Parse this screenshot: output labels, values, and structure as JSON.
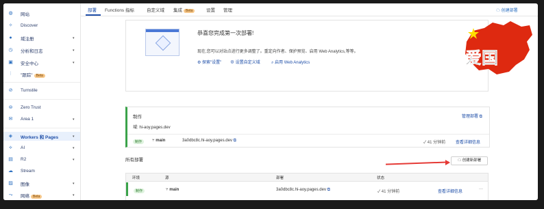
{
  "sidebar": {
    "items": [
      {
        "label": "网站",
        "icon": "globe-icon"
      },
      {
        "label": "Discover",
        "icon": "lightbulb-icon"
      },
      {
        "label": "域注册",
        "icon": "globe-icon",
        "caret": "▾"
      },
      {
        "label": "分析和日志",
        "icon": "clock-icon",
        "caret": "▾"
      },
      {
        "label": "安全中心",
        "icon": "shield-icon",
        "caret": "▾"
      },
      {
        "label": "\"跟踪\"",
        "icon": "route-icon",
        "beta": "Beta"
      },
      {
        "label": "Turnstile",
        "icon": "turnstile-icon"
      },
      {
        "label": "Zero Trust",
        "icon": "zero-trust-icon"
      },
      {
        "label": "Area 1",
        "icon": "mail-icon",
        "caret": "▾"
      },
      {
        "label": "Workers 和 Pages",
        "icon": "workers-icon",
        "caret": "▾"
      },
      {
        "label": "AI",
        "icon": "ai-icon",
        "caret": "▾"
      },
      {
        "label": "R2",
        "icon": "database-icon",
        "caret": "▾"
      },
      {
        "label": "Stream",
        "icon": "cloud-icon"
      },
      {
        "label": "图像",
        "icon": "image-icon",
        "caret": "▾"
      },
      {
        "label": "网络",
        "icon": "network-icon",
        "beta": "Beta",
        "caret": "▾"
      }
    ]
  },
  "tabs": [
    {
      "label": "部署"
    },
    {
      "label": "Functions 指标"
    },
    {
      "label": "自定义域"
    },
    {
      "label": "集成",
      "beta": "Beta"
    },
    {
      "label": "设置"
    },
    {
      "label": "管理"
    }
  ],
  "header": {
    "create_deployment_link": "创建部署"
  },
  "congrats": {
    "title": "恭喜您完成第一次部署!",
    "description": "现在,您可以对站点进行更多调整了。重定向作者、保护预览、启用 Web Analytics,等等。",
    "links": [
      "探索\"设置\"",
      "设置自定义域",
      "启用 Web Analytics"
    ]
  },
  "production": {
    "label": "制作",
    "domain_prefix": "域:",
    "domain": "hi-aoy.pages.dev",
    "manage_link": "管理部署",
    "badge": "制作",
    "branch": "main",
    "deployment": "3a0dbc8c.hi-aoy.pages.dev",
    "time": "41 分钟前",
    "details_link": "查看详细信息"
  },
  "all_deployments": {
    "title": "所有部署",
    "create_button": "创建新部署",
    "headers": [
      "环境",
      "源",
      "部署",
      "状态"
    ],
    "rows": [
      {
        "env": "制作",
        "source": "main",
        "deployment": "3a0dbc8c.hi-aoy.pages.dev",
        "status": "41 分钟前",
        "details": "查看详细信息",
        "more": "···"
      }
    ]
  },
  "overlay": {
    "text": "爱国",
    "flag_color": "#de2910",
    "star_color": "#ffde00"
  },
  "colors": {
    "accent": "#1e4ea8",
    "success": "#3ba34a",
    "arrow": "#e53935"
  }
}
